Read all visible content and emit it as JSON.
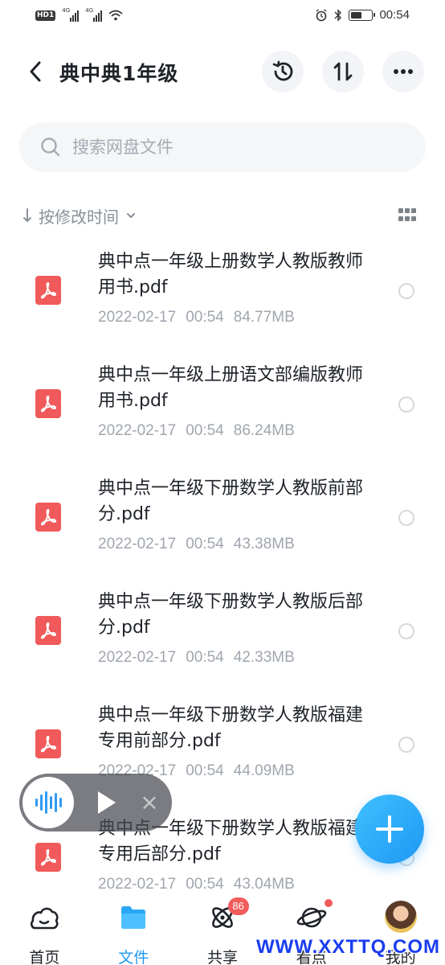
{
  "status_bar": {
    "hd_label": "HD",
    "sim_slot": "1",
    "net_1": "4G",
    "net_2": "4G",
    "time": "00:54",
    "battery_level": 0.55
  },
  "header": {
    "title": "典中典1年级"
  },
  "search": {
    "placeholder": "搜索网盘文件"
  },
  "sort": {
    "label": "按修改时间"
  },
  "files": [
    {
      "name": "典中点一年级上册数学人教版教师用书.pdf",
      "date": "2022-02-17",
      "time": "00:54",
      "size": "84.77MB"
    },
    {
      "name": "典中点一年级上册语文部编版教师用书.pdf",
      "date": "2022-02-17",
      "time": "00:54",
      "size": "86.24MB"
    },
    {
      "name": "典中点一年级下册数学人教版前部分.pdf",
      "date": "2022-02-17",
      "time": "00:54",
      "size": "43.38MB"
    },
    {
      "name": "典中点一年级下册数学人教版后部分.pdf",
      "date": "2022-02-17",
      "time": "00:54",
      "size": "42.33MB"
    },
    {
      "name": "典中点一年级下册数学人教版福建专用前部分.pdf",
      "date": "2022-02-17",
      "time": "00:54",
      "size": "44.09MB"
    },
    {
      "name": "典中点一年级下册数学人教版福建专用后部分.pdf",
      "date": "2022-02-17",
      "time": "00:54",
      "size": "43.04MB"
    }
  ],
  "bottom_nav": {
    "tabs": [
      {
        "label": "首页",
        "icon": "cloud-home-icon"
      },
      {
        "label": "文件",
        "icon": "folder-icon"
      },
      {
        "label": "共享",
        "icon": "atom-share-icon",
        "badge": "86"
      },
      {
        "label": "看点",
        "icon": "planet-icon"
      },
      {
        "label": "我的",
        "icon": "avatar"
      }
    ],
    "active_tab": "文件"
  },
  "watermark": "WWW.XXTTQ.COM",
  "colors": {
    "accent": "#1e98f3",
    "pdf_red": "#f05a5a",
    "badge_red": "#f25b5b",
    "meta_gray": "#a0a6ae"
  }
}
